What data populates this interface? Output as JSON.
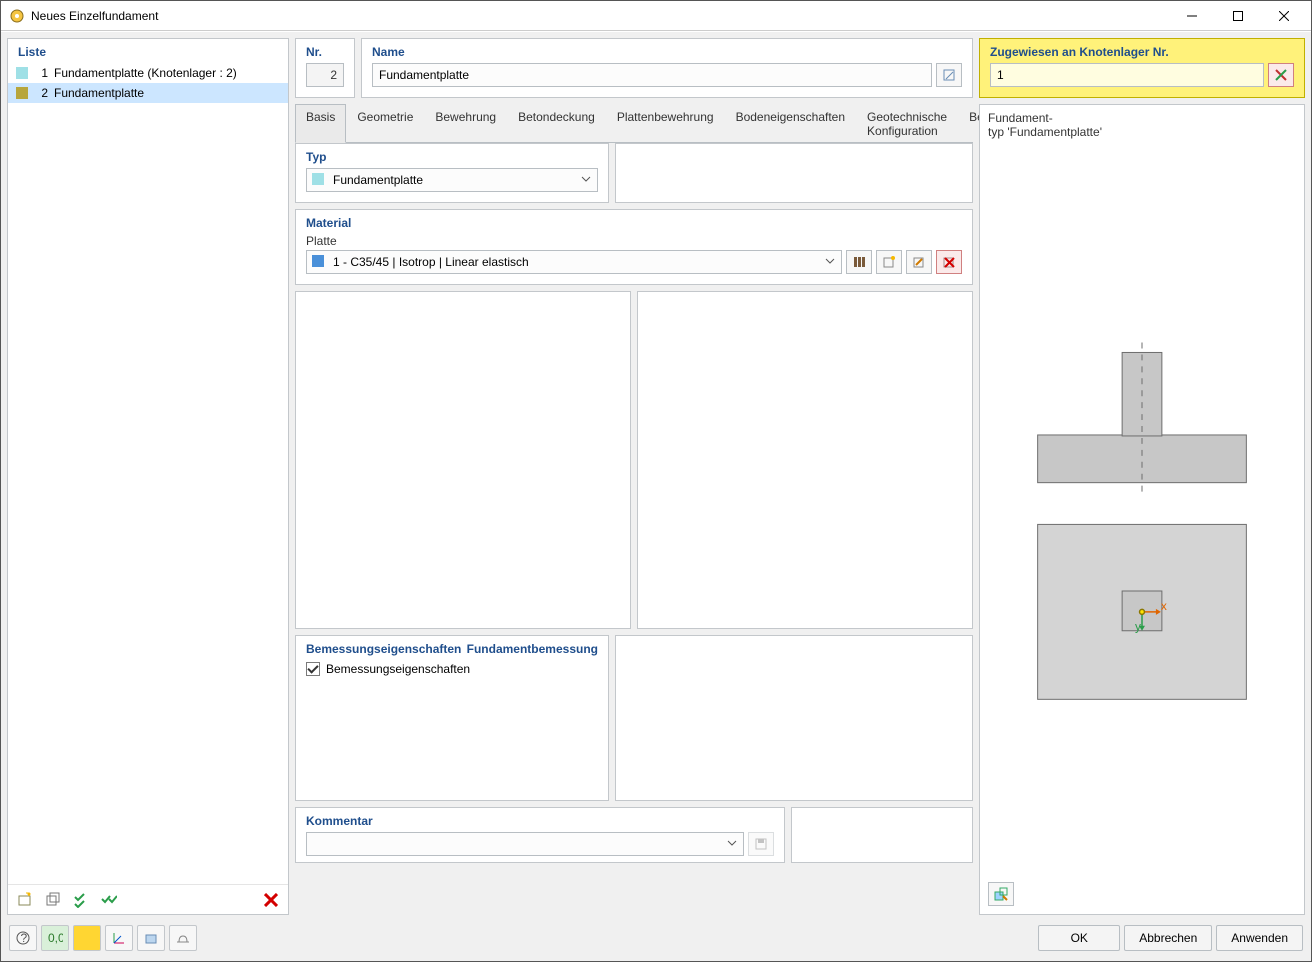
{
  "window": {
    "title": "Neues Einzelfundament"
  },
  "left": {
    "header": "Liste",
    "items": [
      {
        "num": "1",
        "label": "Fundamentplatte (Knotenlager : 2)",
        "color": "#9fe0e6"
      },
      {
        "num": "2",
        "label": "Fundamentplatte",
        "color": "#b7a63d"
      }
    ]
  },
  "header": {
    "nr_label": "Nr.",
    "nr_value": "2",
    "name_label": "Name",
    "name_value": "Fundamentplatte",
    "assign_label": "Zugewiesen an Knotenlager Nr.",
    "assign_value": "1"
  },
  "tabs": [
    "Basis",
    "Geometrie",
    "Bewehrung",
    "Betondeckung",
    "Plattenbewehrung",
    "Bodeneigenschaften",
    "Geotechnische Konfiguration",
    "Betonkonfiguration"
  ],
  "typ": {
    "title": "Typ",
    "value": "Fundamentplatte",
    "sw": "#9fe0e6"
  },
  "material": {
    "title": "Material",
    "sub": "Platte",
    "value": "1 - C35/45 | Isotrop | Linear elastisch",
    "sw": "#4a90d9"
  },
  "design": {
    "left_title": "Bemessungseigenschaften",
    "right_title": "Fundamentbemessung",
    "check_label": "Bemessungseigenschaften"
  },
  "comment": {
    "title": "Kommentar"
  },
  "preview": {
    "line1": "Fundament-",
    "line2": "typ 'Fundamentplatte'"
  },
  "buttons": {
    "ok": "OK",
    "cancel": "Abbrechen",
    "apply": "Anwenden"
  }
}
